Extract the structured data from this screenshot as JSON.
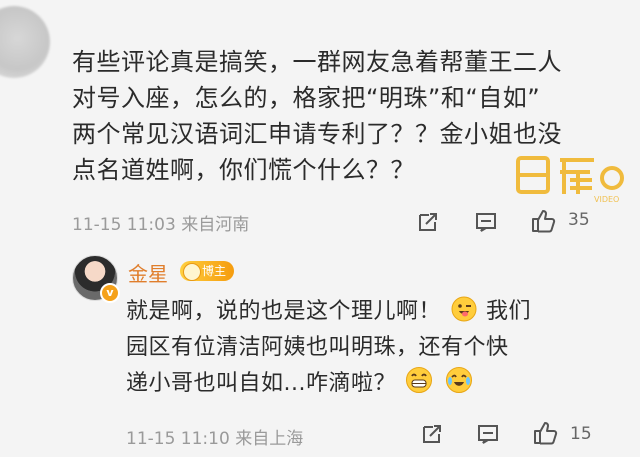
{
  "comment": {
    "lines": [
      "有些评论真是搞笑，一群网友急着帮董王二人",
      "对号入座，怎么的，格家把“明珠”和“自如”",
      "两个常见汉语词汇申请专利了？？金小姐也没",
      "点名道姓啊，你们慌个什么？？"
    ],
    "time_location": "11-15 11:03 来自河南",
    "like_count": "35"
  },
  "reply": {
    "name": "金星",
    "badge": "博主",
    "line1_a": "就是啊，说的也是这个理儿啊！",
    "line1_b": "我们",
    "line2": "园区有位清洁阿姨也叫明珠，还有个快",
    "line3": "递小哥也叫自如...咋滴啦？",
    "time_location": "11-15 11:10 来自上海",
    "like_count": "15"
  },
  "icons": [
    "share-icon",
    "comment-icon",
    "like-icon",
    "wink-tongue-emoji",
    "grin-emoji",
    "laugh-cry-emoji",
    "verified-icon"
  ],
  "colors": {
    "name": "#e07e2c",
    "badge": "#f5a11a",
    "text": "#2b2b2b",
    "meta": "#9a9a9a"
  }
}
